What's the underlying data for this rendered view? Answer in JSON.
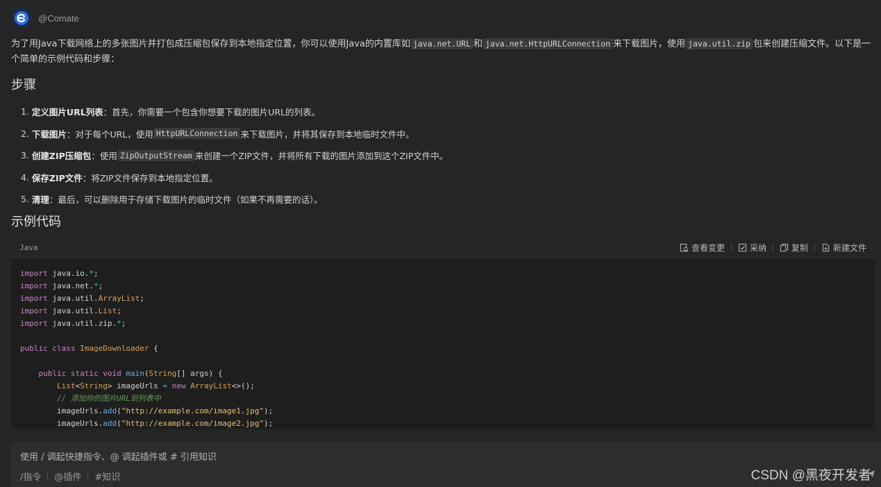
{
  "header": {
    "author": "@Comate"
  },
  "intro": {
    "p1": "为了用Java下载网络上的多张图片并打包成压缩包保存到本地指定位置，你可以使用Java的内置库如",
    "c1": "java.net.URL",
    "p2": "和",
    "c2": "java.net.HttpURLConnection",
    "p3": "来下载图片，使用",
    "c3": "java.util.zip",
    "p4": "包来创建压缩文件。以下是一个简单的示例代码和步骤："
  },
  "headings": {
    "steps": "步骤",
    "example": "示例代码"
  },
  "steps": [
    {
      "num": "1.",
      "bold": "定义图片URL列表",
      "text": "：首先，你需要一个包含你想要下载的图片URL的列表。"
    },
    {
      "num": "2.",
      "bold": "下载图片",
      "text_a": "：对于每个URL，使用",
      "code": "HttpURLConnection",
      "text_b": "来下载图片，并将其保存到本地临时文件中。"
    },
    {
      "num": "3.",
      "bold": "创建ZIP压缩包",
      "text_a": "：使用",
      "code": "ZipOutputStream",
      "text_b": "来创建一个ZIP文件，并将所有下载的图片添加到这个ZIP文件中。"
    },
    {
      "num": "4.",
      "bold": "保存ZIP文件",
      "text": "：将ZIP文件保存到本地指定位置。"
    },
    {
      "num": "5.",
      "bold": "清理",
      "text": "：最后，可以删除用于存储下载图片的临时文件（如果不再需要的话）。"
    }
  ],
  "codeblock": {
    "language": "Java",
    "actions": {
      "view_diff": "查看变更",
      "adopt": "采纳",
      "copy": "复制",
      "new_file": "新建文件"
    },
    "t": {
      "import": "import",
      "java_io": "java.io.",
      "java_net": "java.net.",
      "java_util": "java.util.",
      "java_util_zip": "java.util.zip.",
      "star": "*",
      "semi": ";",
      "ArrayList": "ArrayList",
      "List": "List",
      "public": "public",
      "class": "class",
      "ImageDownloader": "ImageDownloader",
      "lbrace": " {",
      "static": "static",
      "void": "void",
      "main": "main",
      "lparen": "(",
      "String": "String",
      "main_args": "[] args) {",
      "lt": "<",
      "gt": ">",
      "imageUrls_decl": " imageUrls ",
      "eq": "=",
      "new": "new",
      "diamond": "<>();",
      "comment": "// 添加你的图片URL到列表中",
      "imageUrls_dot": "imageUrls.",
      "add": "add",
      "url1": "\"http://example.com/image1.jpg\"",
      "url2": "\"http://example.com/image2.jpg\"",
      "close_call": ");"
    }
  },
  "input": {
    "placeholder": "使用 / 调起快捷指令、@ 调起插件或 # 引用知识",
    "shortcuts": [
      "/指令",
      "@插件",
      "#知识"
    ]
  },
  "watermark": "CSDN @黑夜开发者"
}
